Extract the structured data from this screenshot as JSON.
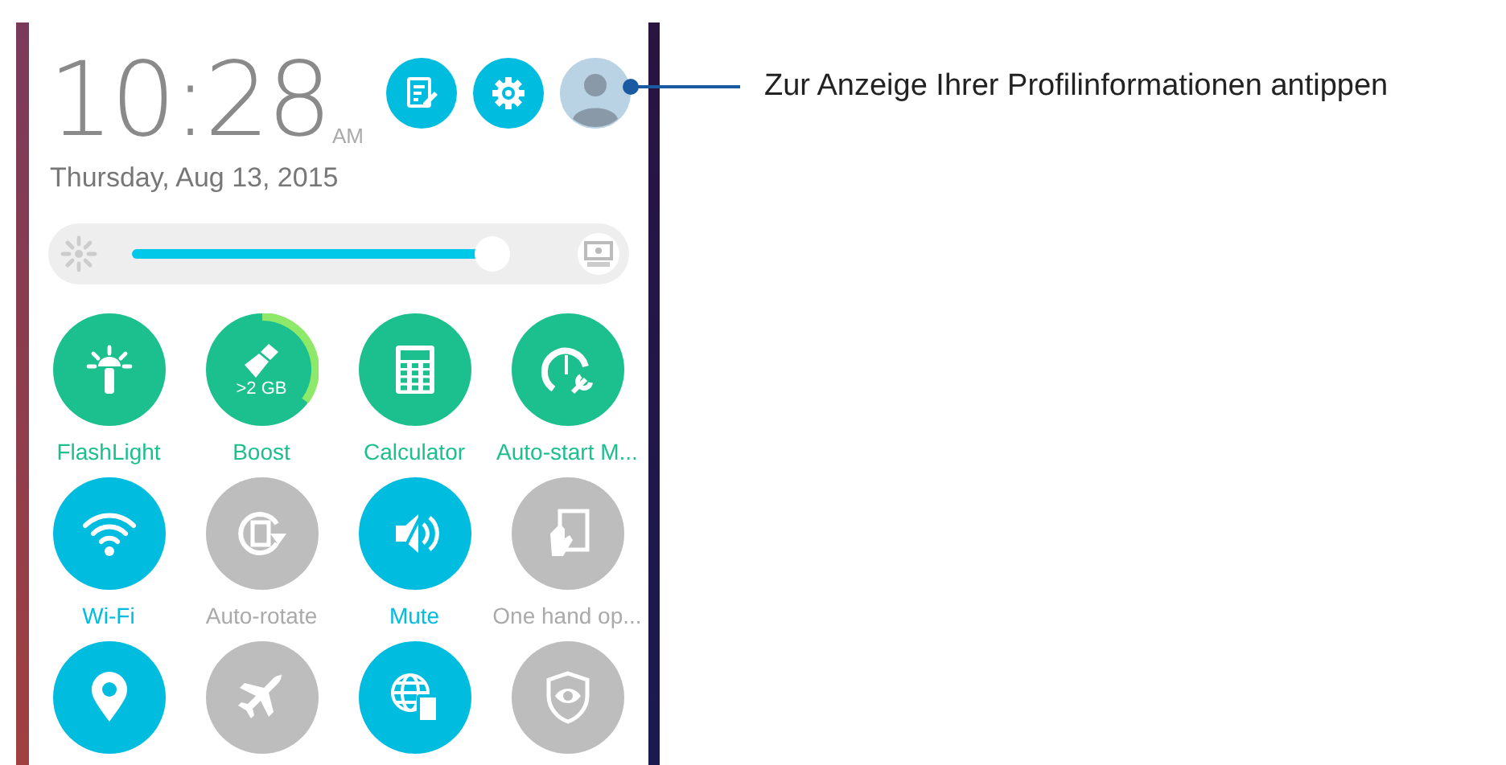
{
  "clock": {
    "time": "10:28",
    "ampm": "AM",
    "date": "Thursday, Aug 13, 2015"
  },
  "brightness": {
    "level": 0.91
  },
  "tiles": [
    {
      "kind": "app",
      "label": "FlashLight"
    },
    {
      "kind": "app",
      "label": "Boost",
      "badge": ">2 GB"
    },
    {
      "kind": "app",
      "label": "Calculator"
    },
    {
      "kind": "app",
      "label": "Auto-start M..."
    },
    {
      "kind": "toggle",
      "label": "Wi-Fi",
      "on": true
    },
    {
      "kind": "toggle",
      "label": "Auto-rotate",
      "on": false
    },
    {
      "kind": "toggle",
      "label": "Mute",
      "on": true
    },
    {
      "kind": "toggle",
      "label": "One hand op...",
      "on": false
    },
    {
      "kind": "toggle",
      "on": true
    },
    {
      "kind": "toggle",
      "on": false
    },
    {
      "kind": "toggle",
      "on": true
    },
    {
      "kind": "toggle",
      "on": false
    }
  ],
  "callout": {
    "text": "Zur Anzeige Ihrer Profilinformationen antippen"
  }
}
